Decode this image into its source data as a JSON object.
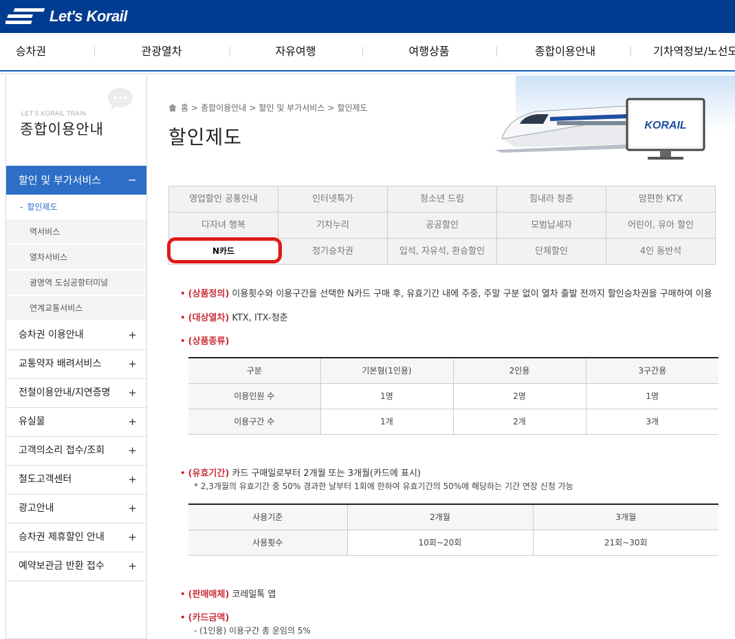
{
  "logo": {
    "text": "Let's Korail"
  },
  "gnb": [
    "승차권",
    "관광열차",
    "자유여행",
    "여행상품",
    "종합이용안내",
    "기차역정보/노선도"
  ],
  "lnb": {
    "subtitle": "LET'S KORAIL TRAIN",
    "title": "종합이용안내",
    "active": {
      "label": "할인 및 부가서비스",
      "toggle": "−"
    },
    "sub_items": [
      "할인제도",
      "역서비스",
      "열차서비스",
      "광명역 도심공항터미널",
      "연계교통서비스"
    ],
    "items": [
      "승차권 이용안내",
      "교통약자 배려서비스",
      "전철이용안내/지연증명",
      "유실물",
      "고객의소리 접수/조회",
      "철도고객센터",
      "광고안내",
      "승차권 제휴할인 안내",
      "예약보관금 반환 접수"
    ],
    "plus": "+"
  },
  "breadcrumb": [
    "홈",
    "종합이용안내",
    "할인 및 부가서비스",
    "할인제도"
  ],
  "page_title": "할인제도",
  "hero_brand": "KORAIL",
  "tabs": [
    [
      "영업할인 공통안내",
      "인터넷특가",
      "청소년 드림",
      "힘내라 청춘",
      "맘편한 KTX"
    ],
    [
      "다자녀 행복",
      "기차누리",
      "공공할인",
      "모범납세자",
      "어린이, 유아 할인"
    ],
    [
      "N카드",
      "정기승차권",
      "입석, 자유석, 환승할인",
      "단체할인",
      "4인 동반석"
    ]
  ],
  "selected_tab": "N카드",
  "sections": {
    "def_label": "(상품정의)",
    "def_text": "이용횟수와 이용구간을 선택한 N카드 구매 후, 유효기간 내에 주중, 주말 구분 없이 열차 출발 전까지 할인승차권을 구매하여 이용",
    "train_label": "(대상열차)",
    "train_text": "KTX, ITX-청춘",
    "kind_label": "(상품종류)",
    "valid_label": "(유효기간)",
    "valid_text": "카드 구매일로부터 2개월 또는 3개월(카드에 표시)",
    "valid_note": "* 2,3개월의 유효기간 중 50% 경과한 날부터 1회에 한하여 유효기간의 50%에 해당하는 기간 연장 신청 가능",
    "sale_label": "(판매매체)",
    "sale_text": "코레일톡 앱",
    "price_label": "(카드금액)",
    "price_note": "- (1인용) 이용구간 총 운임의 5%"
  },
  "table1": {
    "header": [
      "구분",
      "기본형(1인용)",
      "2인용",
      "3구간용"
    ],
    "rows": [
      [
        "이용인원 수",
        "1명",
        "2명",
        "1명"
      ],
      [
        "이용구간 수",
        "1개",
        "2개",
        "3개"
      ]
    ]
  },
  "table2": {
    "header": [
      "사용기준",
      "2개월",
      "3개월"
    ],
    "rows": [
      [
        "사용횟수",
        "10회~20회",
        "21회~30회"
      ]
    ]
  },
  "bullet": "•"
}
